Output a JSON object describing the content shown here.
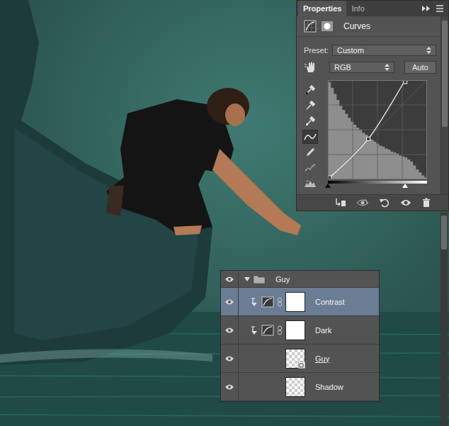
{
  "properties": {
    "tabs": [
      {
        "label": "Properties",
        "selected": true
      },
      {
        "label": "Info",
        "selected": false
      }
    ],
    "title": "Curves",
    "preset_label": "Preset:",
    "preset": "Custom",
    "channel": "RGB",
    "auto_button": "Auto",
    "tools": [
      {
        "kind": "eyedropper-black",
        "selected": false
      },
      {
        "kind": "eyedropper-gray",
        "selected": false
      },
      {
        "kind": "eyedropper-white",
        "selected": false
      },
      {
        "kind": "curve",
        "selected": true
      },
      {
        "kind": "pencil",
        "selected": false
      },
      {
        "kind": "smooth",
        "selected": false
      },
      {
        "kind": "clip-warning",
        "selected": false
      }
    ],
    "curve": {
      "points": [
        [
          0,
          0
        ],
        [
          104,
          104
        ],
        [
          199,
          255
        ]
      ],
      "histogram": [
        98,
        92,
        86,
        80,
        74,
        70,
        66,
        62,
        58,
        55,
        52,
        50,
        47,
        45,
        42,
        40,
        38,
        36,
        34,
        33,
        31,
        30,
        28,
        27,
        26,
        24,
        23,
        22,
        20,
        18,
        14,
        10,
        7,
        4,
        2
      ],
      "input_black": 0,
      "input_white": 199
    }
  },
  "layers": [
    {
      "name": "Guy",
      "kind": "group",
      "visible": true,
      "selected": false,
      "clipped": false,
      "clip_base": false,
      "expanded": true
    },
    {
      "name": "Contrast",
      "kind": "adjustment",
      "visible": true,
      "selected": true,
      "clipped": true,
      "clip_base": false
    },
    {
      "name": "Dark",
      "kind": "adjustment",
      "visible": true,
      "selected": false,
      "clipped": true,
      "clip_base": false
    },
    {
      "name": "Guy",
      "kind": "smart",
      "visible": true,
      "selected": false,
      "clipped": false,
      "clip_base": true
    },
    {
      "name": "Shadow",
      "kind": "pixel",
      "visible": true,
      "selected": false,
      "clipped": false,
      "clip_base": false
    }
  ]
}
